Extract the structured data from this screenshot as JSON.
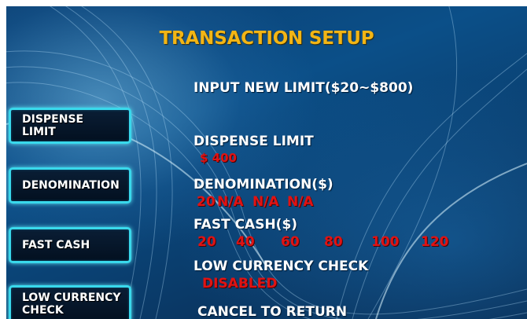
{
  "screen": {
    "title": "TRANSACTION SETUP",
    "instruction": "INPUT NEW LIMIT($20~$800)",
    "footer": "CANCEL TO RETURN"
  },
  "buttons": [
    {
      "label": "DISPENSE\nLIMIT"
    },
    {
      "label": "DENOMINATION"
    },
    {
      "label": "FAST CASH"
    },
    {
      "label": "LOW CURRENCY\nCHECK"
    }
  ],
  "settings": {
    "dispense_limit": {
      "label": "DISPENSE LIMIT",
      "value": "$ 400"
    },
    "denomination": {
      "label": "DENOMINATION($)",
      "values": [
        "20",
        "N/A",
        "N/A",
        "N/A"
      ]
    },
    "fast_cash": {
      "label": "FAST CASH($)",
      "values": [
        "20",
        "40",
        "60",
        "80",
        "100",
        "120"
      ]
    },
    "low_currency_check": {
      "label": "LOW CURRENCY CHECK",
      "value": "DISABLED"
    }
  },
  "colors": {
    "title": "#f2b515",
    "value": "#e01313",
    "button_border": "#39d9ec",
    "background": "#0b4f88"
  }
}
